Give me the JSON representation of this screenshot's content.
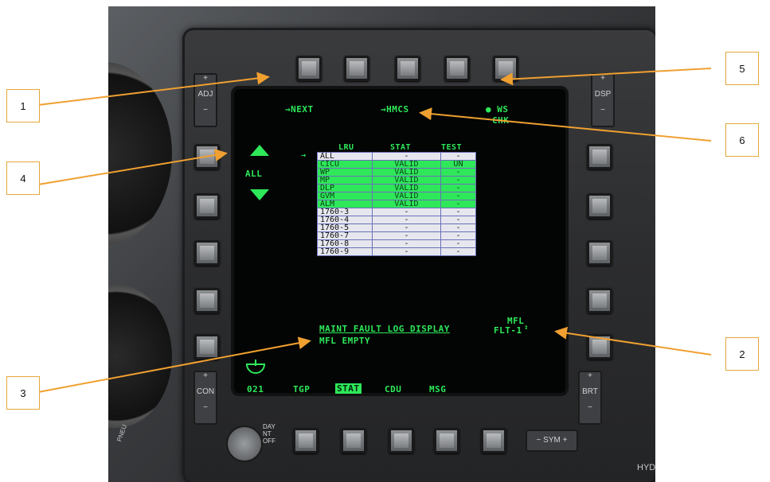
{
  "callouts": [
    "1",
    "2",
    "3",
    "4",
    "5",
    "6"
  ],
  "top_osb_labels": {
    "next": "→NEXT",
    "hmcs": "→HMCS",
    "ws": "● WS",
    "chk": "CHK"
  },
  "left_labels": {
    "all": "ALL"
  },
  "table": {
    "headers": [
      "LRU",
      "STAT",
      "TEST"
    ],
    "rows": [
      {
        "lru": "ALL",
        "stat": "-",
        "test": "-",
        "highlight": false
      },
      {
        "lru": "CICU",
        "stat": "VALID",
        "test": "UN",
        "highlight": true
      },
      {
        "lru": "WP",
        "stat": "VALID",
        "test": "-",
        "highlight": true
      },
      {
        "lru": "MP",
        "stat": "VALID",
        "test": "-",
        "highlight": true
      },
      {
        "lru": "DLP",
        "stat": "VALID",
        "test": "-",
        "highlight": true
      },
      {
        "lru": "GVM",
        "stat": "VALID",
        "test": "-",
        "highlight": true
      },
      {
        "lru": "ALM",
        "stat": "VALID",
        "test": "-",
        "highlight": true
      },
      {
        "lru": "1760-3",
        "stat": "-",
        "test": "-",
        "highlight": false
      },
      {
        "lru": "1760-4",
        "stat": "-",
        "test": "-",
        "highlight": false
      },
      {
        "lru": "1760-5",
        "stat": "-",
        "test": "-",
        "highlight": false
      },
      {
        "lru": "1760-7",
        "stat": "-",
        "test": "-",
        "highlight": false
      },
      {
        "lru": "1760-8",
        "stat": "-",
        "test": "-",
        "highlight": false
      },
      {
        "lru": "1760-9",
        "stat": "-",
        "test": "-",
        "highlight": false
      }
    ]
  },
  "fault_log": {
    "title": "MAINT FAULT LOG DISPLAY",
    "status": "MFL EMPTY"
  },
  "mfl": {
    "label": "MFL",
    "flight": "FLT-1"
  },
  "bottom_osb_labels": [
    "021",
    "TGP",
    "STAT",
    "CDU",
    "MSG"
  ],
  "rockers": {
    "adj": "ADJ",
    "dsp": "DSP",
    "con": "CON",
    "brt": "BRT",
    "sym": "SYM"
  },
  "panel_text": {
    "day": "DAY",
    "nt": "NT",
    "off": "OFF",
    "pneu": "PNEU",
    "hyd": "HYD"
  },
  "colors": {
    "mfcd_green": "#2ee85a",
    "callout_border": "#e3a83a",
    "arrow": "#f0a030"
  }
}
